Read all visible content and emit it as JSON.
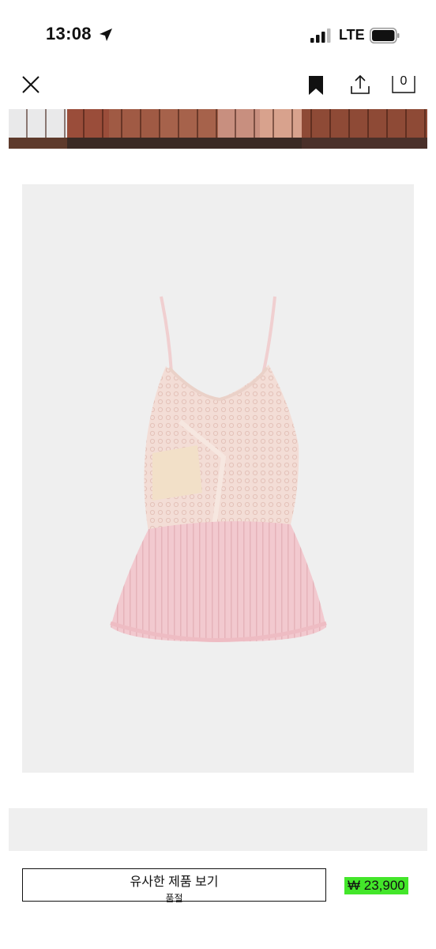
{
  "status_bar": {
    "time": "13:08",
    "network": "LTE",
    "icons": [
      "location-arrow-icon",
      "signal-icon",
      "battery-icon"
    ]
  },
  "nav": {
    "icons": [
      "close-icon",
      "bookmark-icon",
      "share-icon",
      "bag-icon"
    ],
    "bag_count": "0"
  },
  "product": {
    "image_background": "#efefef"
  },
  "bottom_bar": {
    "similar_label": "유사한 제품 보기",
    "similar_sublabel": "품절",
    "price": "₩ 23,900",
    "price_highlight": "#43e62a"
  }
}
